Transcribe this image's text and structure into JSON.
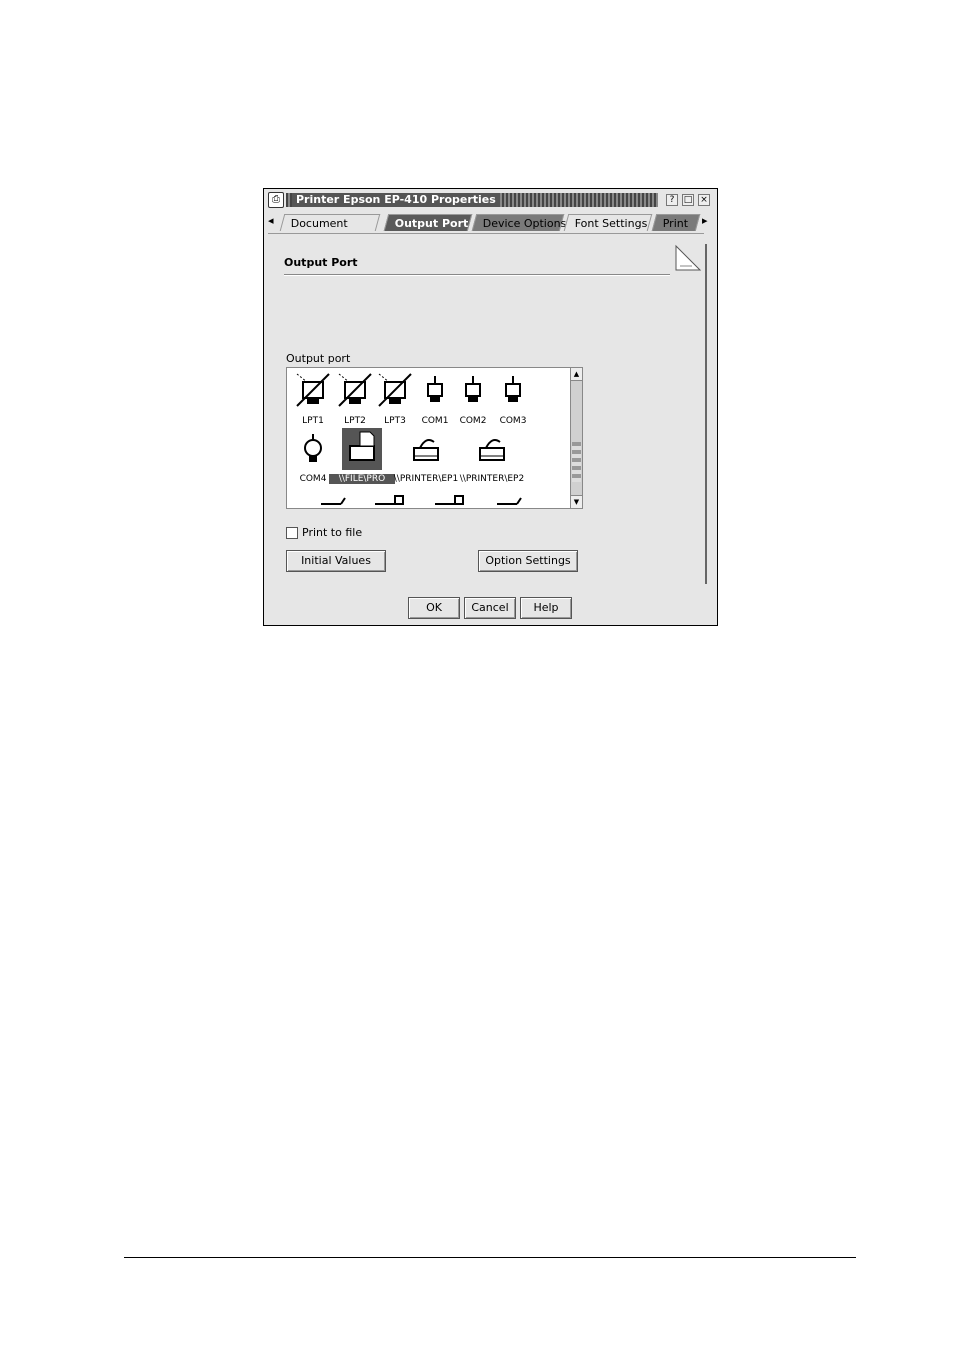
{
  "dialog": {
    "title": "Printer Epson EP-410 Properties",
    "window_buttons": [
      "?",
      "□",
      "×"
    ]
  },
  "tabs": [
    {
      "label": "Document",
      "state": "normal"
    },
    {
      "label": "Output Port",
      "state": "active"
    },
    {
      "label": "Device Options",
      "state": "dark"
    },
    {
      "label": "Font Settings",
      "state": "normal"
    },
    {
      "label": "Print",
      "state": "dark"
    }
  ],
  "section": {
    "title": "Output Port"
  },
  "port_list": {
    "label": "Output port",
    "items": [
      {
        "label": "LPT1",
        "icon": "disabled-printer-icon"
      },
      {
        "label": "LPT2",
        "icon": "disabled-printer-icon"
      },
      {
        "label": "LPT3",
        "icon": "disabled-printer-icon"
      },
      {
        "label": "COM1",
        "icon": "serial-port-icon"
      },
      {
        "label": "COM2",
        "icon": "serial-port-icon"
      },
      {
        "label": "COM3",
        "icon": "serial-port-icon"
      },
      {
        "label": "COM4",
        "icon": "serial-port-icon"
      },
      {
        "label": "\\\\FILE\\PRO",
        "icon": "file-port-icon",
        "selected": true
      },
      {
        "label": "\\\\PRINTER\\EP1",
        "icon": "network-printer-icon"
      },
      {
        "label": "\\\\PRINTER\\EP2",
        "icon": "network-printer-icon"
      }
    ]
  },
  "checkbox": {
    "label": "Print to file",
    "checked": false
  },
  "buttons": {
    "info": "Initial Values",
    "options": "Option Settings",
    "ok": "OK",
    "cancel": "Cancel",
    "help": "Help"
  }
}
